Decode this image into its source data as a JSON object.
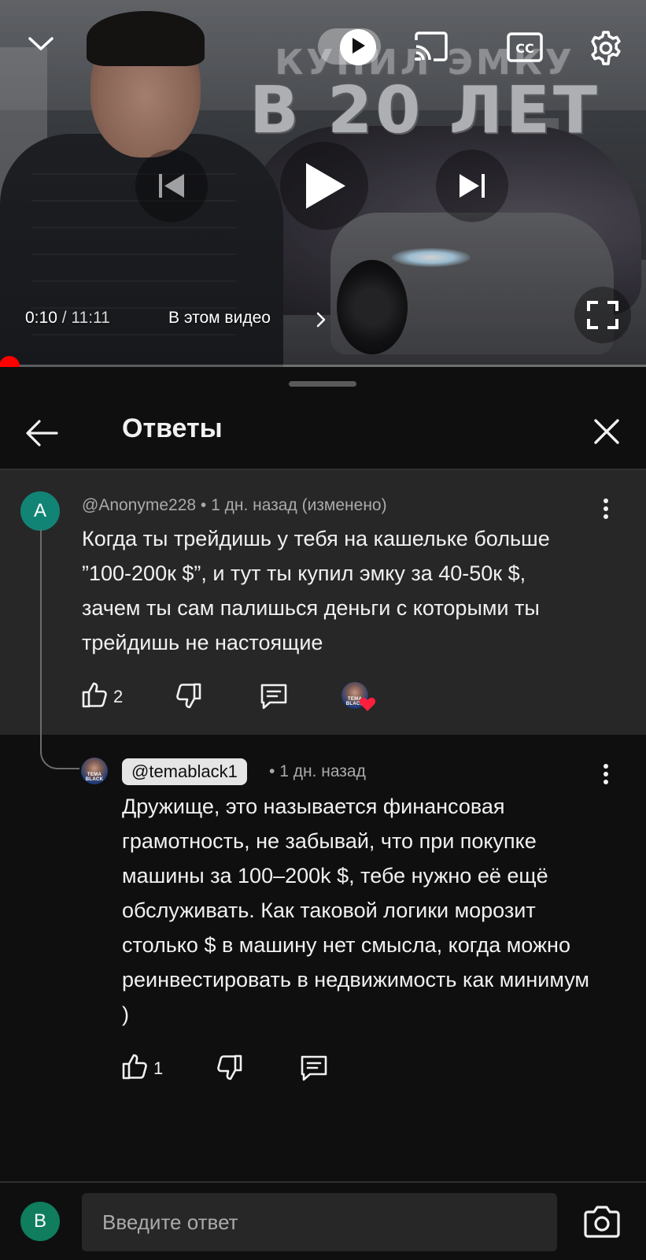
{
  "player": {
    "thumbnail_text_top": "КУПИЛ ЭМКУ",
    "thumbnail_text_bottom": "В 20 ЛЕТ",
    "time_current": "0:10",
    "time_separator": " / ",
    "time_total": "11:11",
    "chapter_label": "В этом видео",
    "autoplay_on": true,
    "progress_fraction": 0.015,
    "progress_color": "#ff0000",
    "icons": [
      "chevron-down-icon",
      "cast-icon",
      "captions-icon",
      "gear-icon",
      "previous-icon",
      "play-icon",
      "next-icon",
      "fullscreen-icon",
      "chevron-right-icon"
    ]
  },
  "sheet": {
    "title": "Ответы"
  },
  "parent_comment": {
    "avatar_letter": "A",
    "avatar_color": "#128476",
    "author": "@Anonyme228",
    "separator": " • ",
    "time": "1 дн. назад (изменено)",
    "text": "Когда ты трейдишь у тебя на кашельке больше ”100-200к $”, и тут ты купил эмку за 40-50к $, зачем ты сам палишься деньги с которыми ты трейдишь не настоящие",
    "likes": "2",
    "creator_hearted": true,
    "creator_avatar_text": "TEMA BLACK"
  },
  "reply_comment": {
    "author": "@temablack1",
    "separator": " • ",
    "time": "1 дн. назад",
    "text": "Дружище, это называется финансовая грамотность, не забывай, что при покупке машины за 100–200k $, тебе нужно её ещё обслуживать. Как таковой логики морозит столько $ в машину нет смысла, когда можно реинвестировать в недвижимость как минимум )",
    "likes": "1",
    "avatar_text": "TEMA BLACK"
  },
  "reply_bar": {
    "avatar_letter": "B",
    "avatar_color": "#0f7d5e",
    "placeholder": "Введите ответ"
  }
}
